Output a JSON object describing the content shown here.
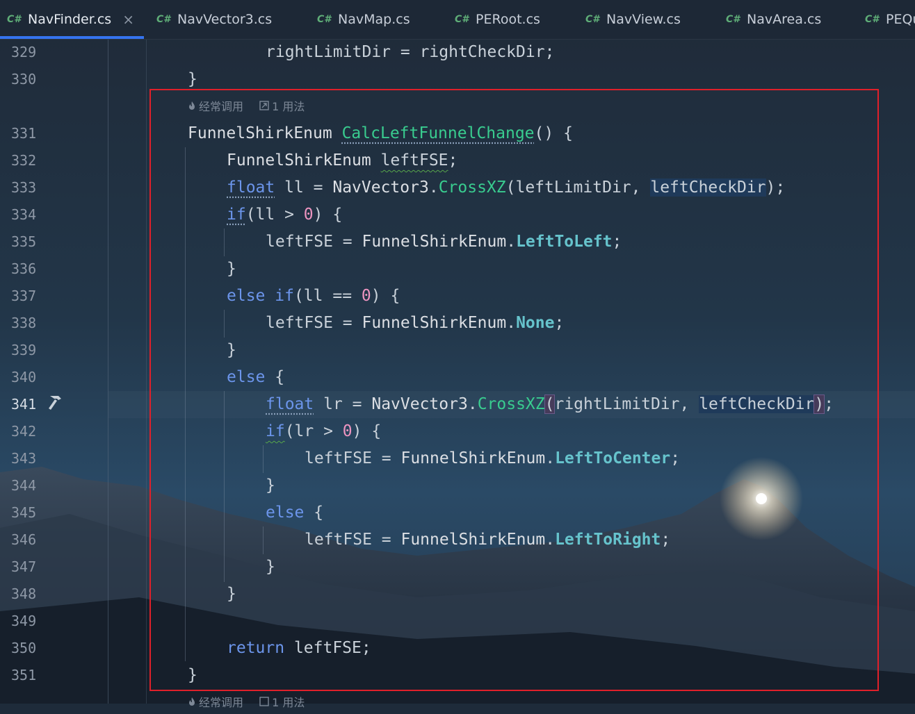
{
  "tabs": [
    {
      "lang": "C#",
      "label": "NavFinder.cs",
      "active": true,
      "close": "×"
    },
    {
      "lang": "C#",
      "label": "NavVector3.cs"
    },
    {
      "lang": "C#",
      "label": "NavMap.cs"
    },
    {
      "lang": "C#",
      "label": "PERoot.cs"
    },
    {
      "lang": "C#",
      "label": "NavView.cs"
    },
    {
      "lang": "C#",
      "label": "NavArea.cs"
    },
    {
      "lang": "C#",
      "label": "PEQu"
    }
  ],
  "hints": {
    "frequent": "经常调用",
    "usages": "1 用法"
  },
  "line_numbers": [
    "329",
    "330",
    "331",
    "332",
    "333",
    "334",
    "335",
    "336",
    "337",
    "338",
    "339",
    "340",
    "341",
    "342",
    "343",
    "344",
    "345",
    "346",
    "347",
    "348",
    "349",
    "350",
    "351"
  ],
  "current_line": "341",
  "gutter_icon": "hammer-icon",
  "colors": {
    "keyword": "#6c95eb",
    "method": "#39cc8f",
    "enum_member": "#66c3cc",
    "number": "#ed94c0",
    "highlight_box": "#e0202a",
    "tab_underline": "#3574f0"
  },
  "code": {
    "l329": {
      "a": "rightLimitDir",
      "b": " = ",
      "c": "rightCheckDir",
      "d": ";"
    },
    "l330": {
      "a": "}"
    },
    "l331": {
      "type": "FunnelShirkEnum",
      "sp": " ",
      "name": "CalcLeftFunnelChange",
      "rest": "() {"
    },
    "l332": {
      "type": "FunnelShirkEnum",
      "sp": " ",
      "var": "leftFSE",
      "rest": ";"
    },
    "l333": {
      "kw": "float",
      "a": " ll = ",
      "cls": "NavVector3",
      "dot": ".",
      "m": "CrossXZ",
      "p1": "(leftLimitDir, ",
      "p2": "leftCheckDir",
      "end": ");"
    },
    "l334": {
      "kw": "if",
      "a": "(ll > ",
      "n": "0",
      "b": ") {"
    },
    "l335": {
      "a": "leftFSE = ",
      "cls": "FunnelShirkEnum",
      "dot": ".",
      "e": "LeftToLeft",
      "end": ";"
    },
    "l336": {
      "a": "}"
    },
    "l337": {
      "kw1": "else",
      "sp": " ",
      "kw2": "if",
      "a": "(ll == ",
      "n": "0",
      "b": ") {"
    },
    "l338": {
      "a": "leftFSE = ",
      "cls": "FunnelShirkEnum",
      "dot": ".",
      "e": "None",
      "end": ";"
    },
    "l339": {
      "a": "}"
    },
    "l340": {
      "kw": "else",
      "a": " {"
    },
    "l341": {
      "kw": "float",
      "a": " lr = ",
      "cls": "NavVector3",
      "dot": ".",
      "m": "CrossXZ",
      "open": "(",
      "p1": "rightLimitDir, ",
      "p2": "leftCheckDir",
      "close": ")",
      "end": ";"
    },
    "l342": {
      "kw": "if",
      "a": "(lr > ",
      "n": "0",
      "b": ") {"
    },
    "l343": {
      "a": "leftFSE = ",
      "cls": "FunnelShirkEnum",
      "dot": ".",
      "e": "LeftToCenter",
      "end": ";"
    },
    "l344": {
      "a": "}"
    },
    "l345": {
      "kw": "else",
      "a": " {"
    },
    "l346": {
      "a": "leftFSE = ",
      "cls": "FunnelShirkEnum",
      "dot": ".",
      "e": "LeftToRight",
      "end": ";"
    },
    "l347": {
      "a": "}"
    },
    "l348": {
      "a": "}"
    },
    "l350": {
      "kw": "return",
      "a": " leftFSE;"
    },
    "l351": {
      "a": "}"
    }
  }
}
